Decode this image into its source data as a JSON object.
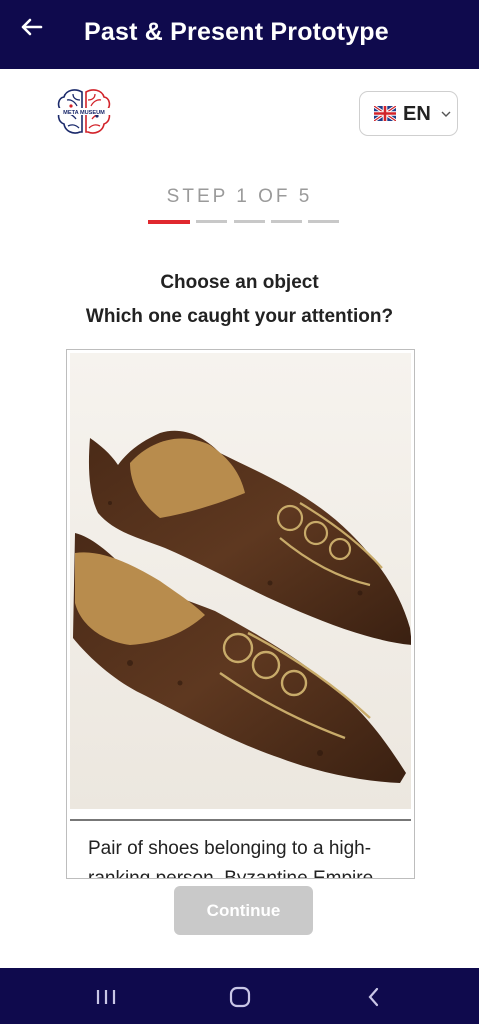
{
  "appbar": {
    "title": "Past & Present Prototype",
    "back_icon": "arrow-left-icon"
  },
  "logo": {
    "icon": "meta-museum-brain-logo",
    "brand_text": "META MUSEUM"
  },
  "language": {
    "flag_icon": "uk-flag-icon",
    "code": "EN",
    "chevron_icon": "chevron-down-icon"
  },
  "stepper": {
    "label": "STEP 1 OF 5",
    "current_step": 1,
    "total_steps": 5,
    "active_color": "#e0282e",
    "inactive_color": "#c8c8c8"
  },
  "prompt": {
    "title": "Choose an object",
    "subtitle": "Which one caught your attention?"
  },
  "object_card": {
    "image_icon": "byzantine-shoes-photo",
    "caption": "Pair of shoes belonging to a high-ranking person, Byzantine Empire"
  },
  "continue_button": {
    "label": "Continue",
    "enabled": false
  },
  "system_nav": {
    "recents_icon": "recent-apps-icon",
    "home_icon": "home-icon",
    "back_icon": "back-chevron-icon"
  },
  "colors": {
    "bar_background": "#0f0a4d",
    "accent_red": "#e0282e",
    "disabled_button": "#c9c9c9"
  }
}
